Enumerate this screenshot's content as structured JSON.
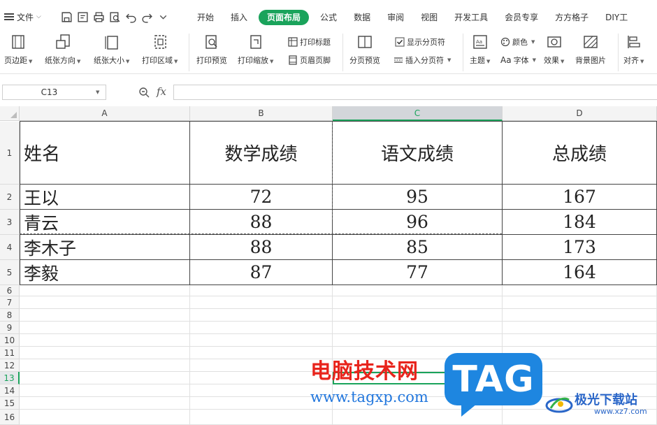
{
  "app": {
    "file_menu": "文件",
    "tabs": [
      {
        "label": "开始"
      },
      {
        "label": "插入"
      },
      {
        "label": "页面布局",
        "active": true
      },
      {
        "label": "公式"
      },
      {
        "label": "数据"
      },
      {
        "label": "审阅"
      },
      {
        "label": "视图"
      },
      {
        "label": "开发工具"
      },
      {
        "label": "会员专享"
      },
      {
        "label": "方方格子"
      },
      {
        "label": "DIY工"
      }
    ],
    "accent_color": "#1aa35b"
  },
  "ribbon": {
    "margins": "页边距",
    "orientation": "纸张方向",
    "paper_size": "纸张大小",
    "print_area": "打印区域",
    "print_preview": "打印预览",
    "print_scale": "打印缩放",
    "print_titles": "打印标题",
    "header_footer": "页眉页脚",
    "page_break_preview": "分页预览",
    "show_page_breaks": "显示分页符",
    "show_page_breaks_checked": true,
    "insert_page_break": "插入分页符",
    "theme": "主题",
    "colors": "颜色",
    "fonts": "字体",
    "fonts_prefix": "Aa",
    "effects": "效果",
    "background": "背景图片",
    "align": "对齐"
  },
  "formula_bar": {
    "name_box": "C13",
    "fx_label": "fx",
    "formula": ""
  },
  "sheet": {
    "columns": [
      "A",
      "B",
      "C",
      "D"
    ],
    "selected_column": "C",
    "rows": [
      "1",
      "2",
      "3",
      "4",
      "5",
      "6",
      "7",
      "8",
      "9",
      "10",
      "11",
      "12",
      "13",
      "14",
      "15",
      "16"
    ],
    "selected_row": "13",
    "table": {
      "headers": [
        "姓名",
        "数学成绩",
        "语文成绩",
        "总成绩"
      ],
      "records": [
        [
          "王以",
          "72",
          "95",
          "167"
        ],
        [
          "青云",
          "88",
          "96",
          "184"
        ],
        [
          "李木子",
          "88",
          "85",
          "173"
        ],
        [
          "李毅",
          "87",
          "77",
          "164"
        ]
      ]
    }
  },
  "watermark": {
    "title": "电脑技术网",
    "url": "www.tagxp.com",
    "badge": "TAG",
    "site_name": "极光下载站",
    "site_url": "www.xz7.com"
  }
}
